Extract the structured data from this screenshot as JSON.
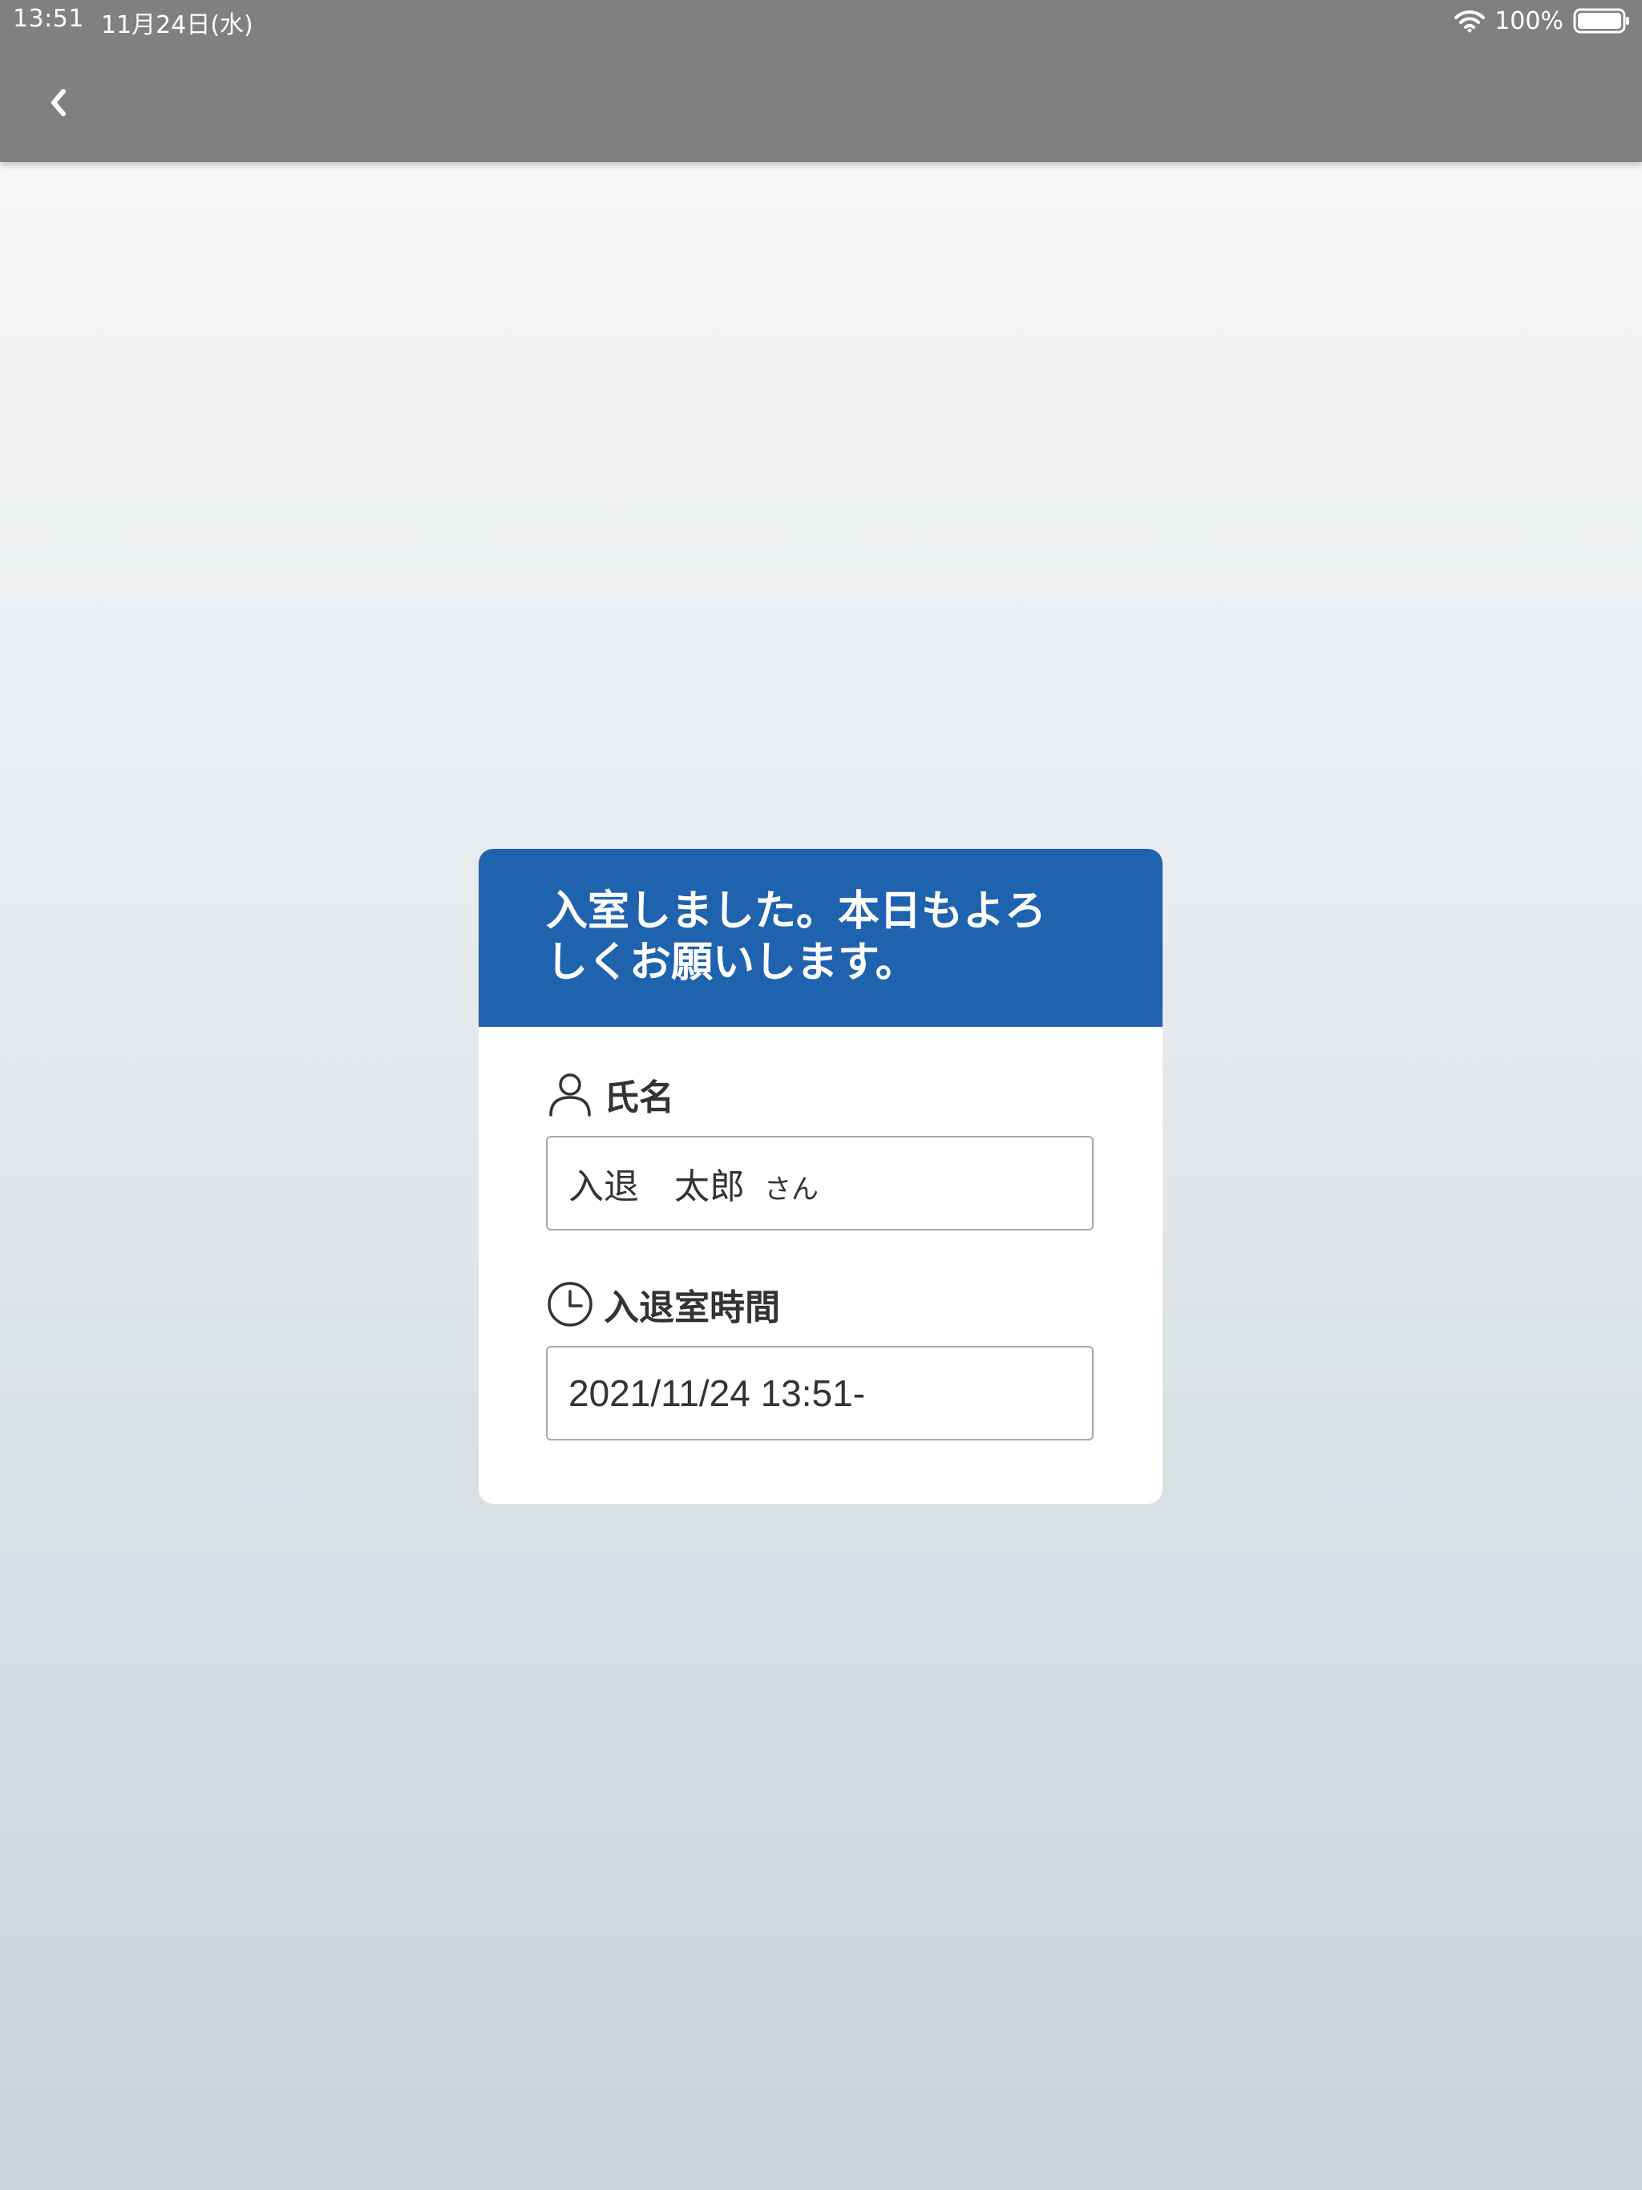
{
  "status_bar": {
    "time": "13:51",
    "date": "11月24日(水)",
    "battery": "100%",
    "icons": [
      "wifi-icon",
      "battery-icon"
    ]
  },
  "nav": {
    "back_icon": "chevron-left-icon"
  },
  "card": {
    "header_color": "#1f63ae",
    "message_line1": "入室しました。本日もよろ",
    "message_line2": "しくお願いします。",
    "name_field": {
      "icon": "person-icon",
      "label": "氏名",
      "value": "入退　太郎",
      "suffix": "さん"
    },
    "time_field": {
      "icon": "clock-icon",
      "label": "入退室時間",
      "value": "2021/11/24 13:51-"
    }
  }
}
